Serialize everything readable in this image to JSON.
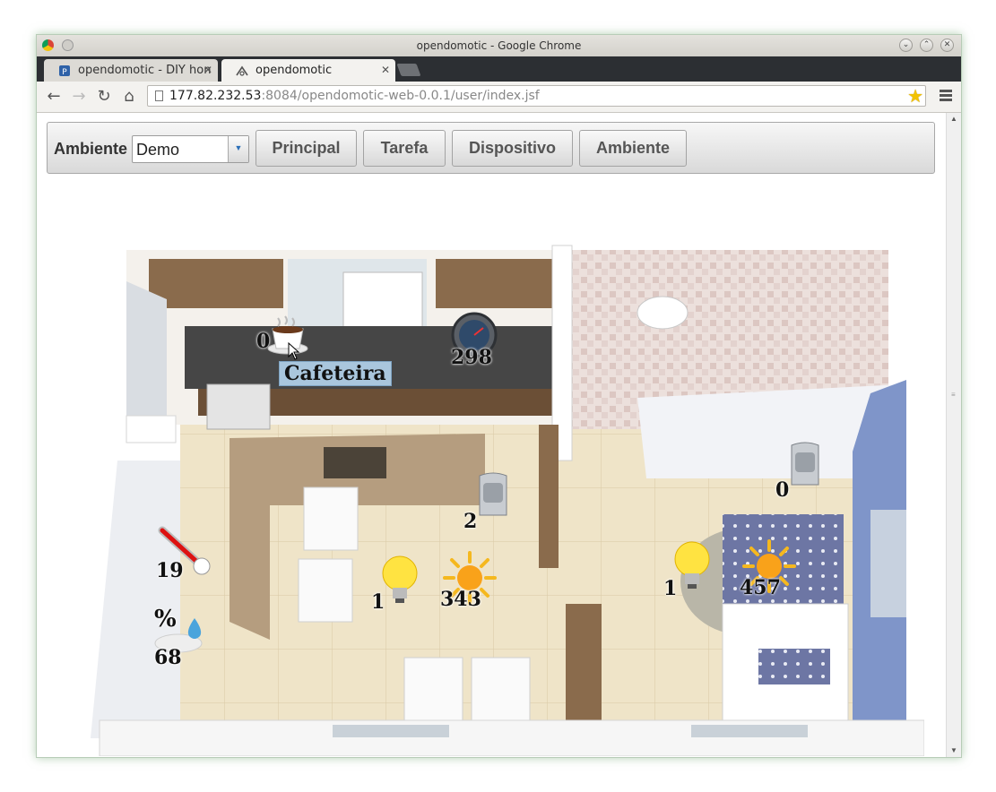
{
  "window": {
    "title": "opendomotic - Google Chrome"
  },
  "tabs": [
    {
      "label": "opendomotic - DIY hon",
      "active": false
    },
    {
      "label": "opendomotic",
      "active": true
    }
  ],
  "address": {
    "host": "177.82.232.53",
    "rest": ":8084/opendomotic-web-0.0.1/user/index.jsf"
  },
  "panel": {
    "ambiente_label": "Ambiente",
    "ambiente_value": "Demo",
    "buttons": [
      "Principal",
      "Tarefa",
      "Dispositivo",
      "Ambiente"
    ]
  },
  "devices": {
    "coffee": {
      "value": "0",
      "tooltip": "Cafeteira",
      "icon": "coffee-cup-icon"
    },
    "gauge": {
      "value": "298",
      "icon": "gauge-meter-icon"
    },
    "sensor_kitchen": {
      "value": "2",
      "icon": "motion-sensor-icon"
    },
    "sensor_bedroom": {
      "value": "0",
      "icon": "motion-sensor-icon"
    },
    "thermometer": {
      "value": "19",
      "icon": "thermometer-icon"
    },
    "humidity": {
      "value": "68",
      "symbol": "%",
      "icon": "humidity-icon"
    },
    "lamp_living": {
      "value": "1",
      "icon": "light-bulb-icon"
    },
    "sun_living": {
      "value": "343",
      "icon": "sun-icon"
    },
    "lamp_bedroom": {
      "value": "1",
      "icon": "light-bulb-icon"
    },
    "sun_bedroom": {
      "value": "457",
      "icon": "sun-icon"
    }
  },
  "colors": {
    "tooltip_bg": "#a9c6dd",
    "wall_blue": "#7f95c9",
    "floor": "#eee2c6"
  }
}
